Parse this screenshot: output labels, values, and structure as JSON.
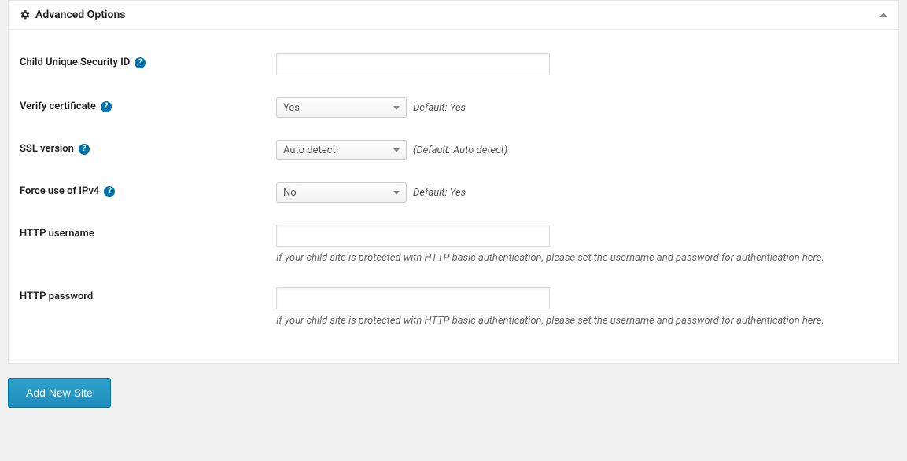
{
  "panel": {
    "title": "Advanced Options"
  },
  "fields": {
    "security_id": {
      "label": "Child Unique Security ID",
      "value": ""
    },
    "verify_cert": {
      "label": "Verify certificate",
      "value": "Yes",
      "hint": "Default: Yes"
    },
    "ssl_version": {
      "label": "SSL version",
      "value": "Auto detect",
      "hint": "(Default: Auto detect)"
    },
    "force_ipv4": {
      "label": "Force use of IPv4",
      "value": "No",
      "hint": "Default: Yes"
    },
    "http_user": {
      "label": "HTTP username",
      "value": "",
      "desc": "If your child site is protected with HTTP basic authentication, please set the username and password for authentication here."
    },
    "http_pass": {
      "label": "HTTP password",
      "value": "",
      "desc": "If your child site is protected with HTTP basic authentication, please set the username and password for authentication here."
    }
  },
  "button": {
    "add_new_site": "Add New Site"
  }
}
